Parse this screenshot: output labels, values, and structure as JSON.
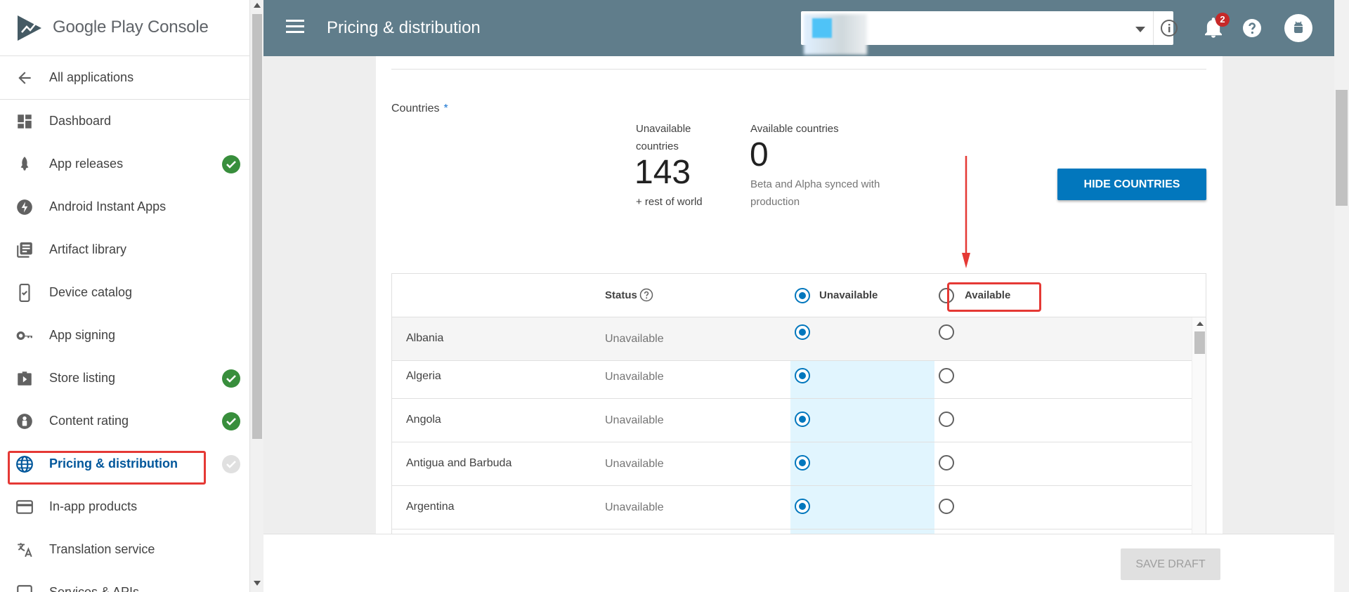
{
  "brand": {
    "name": "Google Play Console"
  },
  "sidebar": {
    "back_label": "All applications",
    "items": [
      {
        "label": "Dashboard",
        "icon": "dashboard-icon",
        "status": "none"
      },
      {
        "label": "App releases",
        "icon": "rocket-icon",
        "status": "complete"
      },
      {
        "label": "Android Instant Apps",
        "icon": "bolt-icon",
        "status": "none"
      },
      {
        "label": "Artifact library",
        "icon": "library-icon",
        "status": "none"
      },
      {
        "label": "Device catalog",
        "icon": "device-icon",
        "status": "none"
      },
      {
        "label": "App signing",
        "icon": "key-icon",
        "status": "none"
      },
      {
        "label": "Store listing",
        "icon": "store-icon",
        "status": "complete"
      },
      {
        "label": "Content rating",
        "icon": "rating-icon",
        "status": "complete"
      },
      {
        "label": "Pricing & distribution",
        "icon": "globe-icon",
        "status": "incomplete",
        "active": true
      },
      {
        "label": "In-app products",
        "icon": "card-icon",
        "status": "none"
      },
      {
        "label": "Translation service",
        "icon": "translate-icon",
        "status": "none"
      },
      {
        "label": "Services & APIs",
        "icon": "services-icon",
        "status": "none"
      }
    ]
  },
  "topbar": {
    "title": "Pricing & distribution",
    "notification_count": "2"
  },
  "countries": {
    "label": "Countries",
    "required_mark": "*",
    "unavailable_label_1": "Unavailable",
    "unavailable_label_2": "countries",
    "unavailable_count": "143",
    "unavailable_sub": "+ rest of world",
    "available_label": "Available countries",
    "available_count": "0",
    "available_sub_1": "Beta and Alpha synced with",
    "available_sub_2": "production",
    "hide_button": "HIDE COUNTRIES"
  },
  "table": {
    "status_header": "Status",
    "col_unavailable": "Unavailable",
    "col_available": "Available",
    "rows": [
      {
        "country": "Albania",
        "status": "Unavailable"
      },
      {
        "country": "Algeria",
        "status": "Unavailable"
      },
      {
        "country": "Angola",
        "status": "Unavailable"
      },
      {
        "country": "Antigua and Barbuda",
        "status": "Unavailable"
      },
      {
        "country": "Argentina",
        "status": "Unavailable"
      }
    ]
  },
  "footer": {
    "save_label": "SAVE DRAFT"
  },
  "colors": {
    "topbar": "#607d8b",
    "primary": "#0277bd",
    "complete": "#388e3c",
    "annotation": "#e53935"
  }
}
